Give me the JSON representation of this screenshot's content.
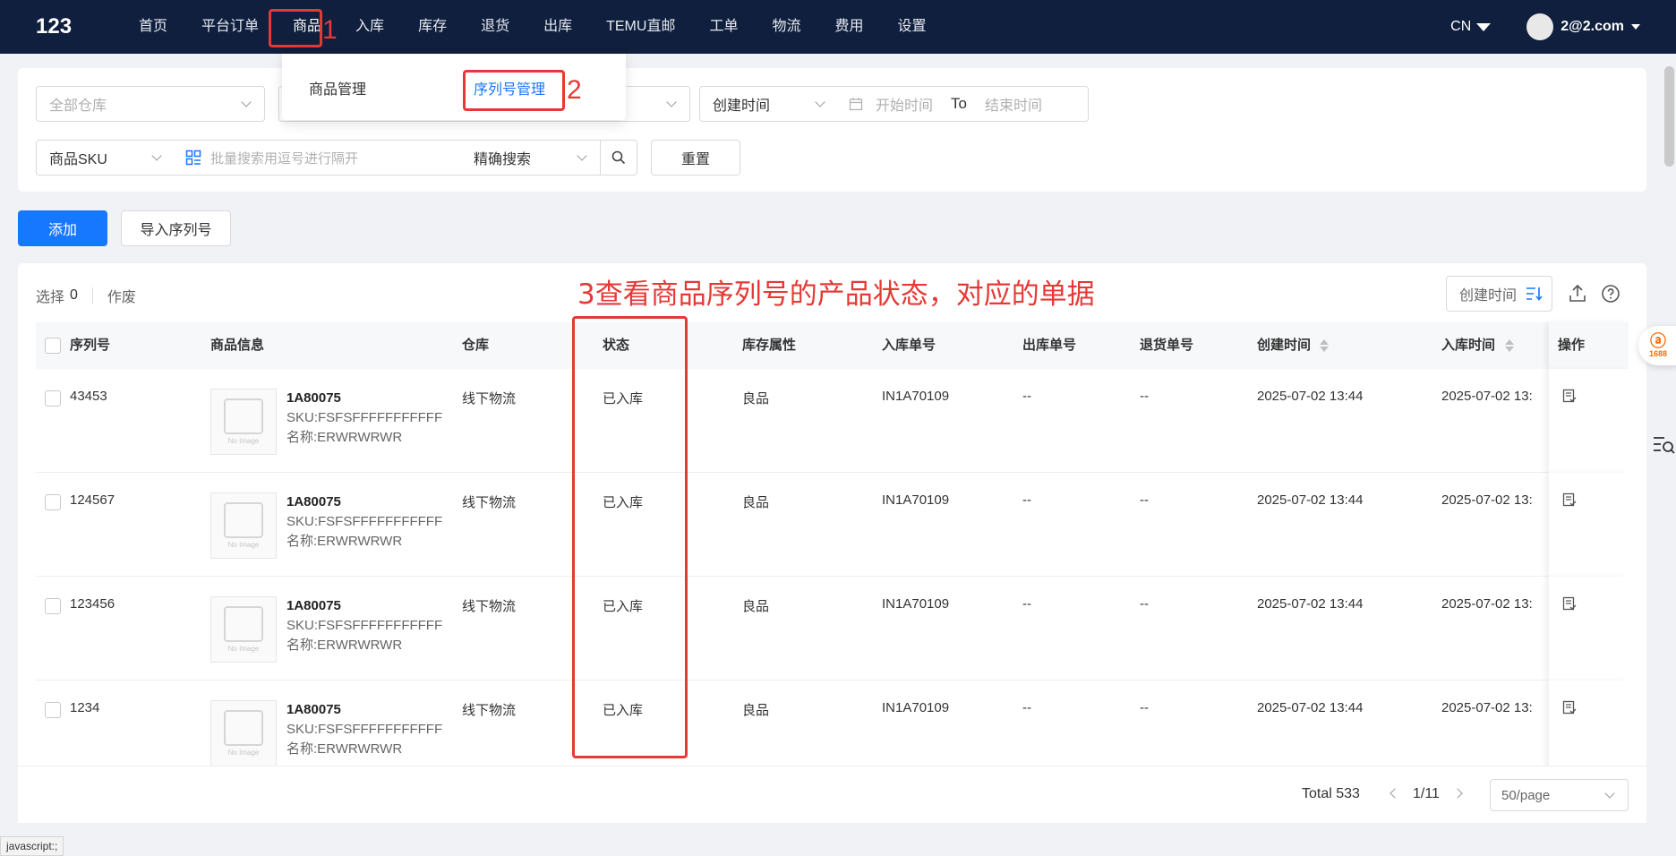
{
  "nav": {
    "logo": "123",
    "items": [
      "首页",
      "平台订单",
      "商品",
      "入库",
      "库存",
      "退货",
      "出库",
      "TEMU直邮",
      "工单",
      "物流",
      "费用",
      "设置"
    ],
    "lang": "CN",
    "user": "2@2.com"
  },
  "dropdown": {
    "items": [
      "商品管理",
      "序列号管理"
    ]
  },
  "annotations": {
    "n1": "1",
    "n2": "2",
    "note3": "3查看商品序列号的产品状态，对应的单据"
  },
  "filters": {
    "warehouse_placeholder": "全部仓库",
    "time_type": "创建时间",
    "start_placeholder": "开始时间",
    "to": "To",
    "end_placeholder": "结束时间",
    "search_field": "商品SKU",
    "search_placeholder": "批量搜索用逗号进行隔开",
    "match_mode": "精确搜索",
    "reset": "重置"
  },
  "actions": {
    "add": "添加",
    "import": "导入序列号"
  },
  "table": {
    "selected_label": "选择",
    "selected_count": "0",
    "void_label": "作废",
    "sort_label": "创建时间",
    "columns": [
      "序列号",
      "商品信息",
      "仓库",
      "状态",
      "库存属性",
      "入库单号",
      "出库单号",
      "退货单号",
      "创建时间",
      "入库时间",
      "操作"
    ],
    "rows": [
      {
        "serial": "43453",
        "code": "1A80075",
        "sku": "SKU:FSFSFFFFFFFFFFF",
        "name": "名称:ERWRWRWR",
        "warehouse": "线下物流",
        "status": "已入库",
        "attr": "良品",
        "inbound": "IN1A70109",
        "outbound": "--",
        "returns": "--",
        "created": "2025-07-02 13:44",
        "intime": "2025-07-02 13:"
      },
      {
        "serial": "124567",
        "code": "1A80075",
        "sku": "SKU:FSFSFFFFFFFFFFF",
        "name": "名称:ERWRWRWR",
        "warehouse": "线下物流",
        "status": "已入库",
        "attr": "良品",
        "inbound": "IN1A70109",
        "outbound": "--",
        "returns": "--",
        "created": "2025-07-02 13:44",
        "intime": "2025-07-02 13:"
      },
      {
        "serial": "123456",
        "code": "1A80075",
        "sku": "SKU:FSFSFFFFFFFFFFF",
        "name": "名称:ERWRWRWR",
        "warehouse": "线下物流",
        "status": "已入库",
        "attr": "良品",
        "inbound": "IN1A70109",
        "outbound": "--",
        "returns": "--",
        "created": "2025-07-02 13:44",
        "intime": "2025-07-02 13:"
      },
      {
        "serial": "1234",
        "code": "1A80075",
        "sku": "SKU:FSFSFFFFFFFFFFF",
        "name": "名称:ERWRWRWR",
        "warehouse": "线下物流",
        "status": "已入库",
        "attr": "良品",
        "inbound": "IN1A70109",
        "outbound": "--",
        "returns": "--",
        "created": "2025-07-02 13:44",
        "intime": "2025-07-02 13:"
      }
    ],
    "no_image": "No Image"
  },
  "pager": {
    "total": "Total 533",
    "page": "1/11",
    "size": "50/page"
  },
  "widget": {
    "brand": "1688"
  },
  "statusbar": "javascript:;"
}
